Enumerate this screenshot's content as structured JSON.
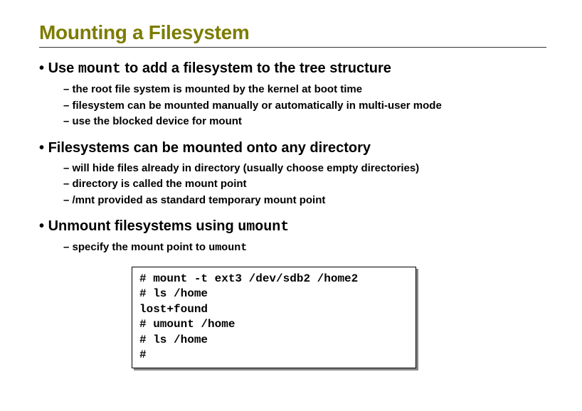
{
  "title": "Mounting a Filesystem",
  "bullets": [
    {
      "prefix": "Use ",
      "mono1": "mount",
      "after": " to add a filesystem to the tree structure",
      "subs": [
        "the root file system is mounted by the kernel at boot time",
        "filesystem can be mounted manually or automatically in multi-user mode",
        "use the blocked device for mount"
      ]
    },
    {
      "prefix": "Filesystems can be mounted onto any directory",
      "mono1": "",
      "after": "",
      "subs": [
        "will hide files already in directory (usually choose empty directories)",
        "directory is called the mount point",
        "/mnt provided as standard temporary mount point"
      ]
    },
    {
      "prefix": "Unmount filesystems using ",
      "mono1": "umount",
      "after": "",
      "subs_special": {
        "text_before": "specify the mount point to ",
        "mono": "umount"
      }
    }
  ],
  "code": "# mount -t ext3 /dev/sdb2 /home2\n# ls /home\nlost+found\n# umount /home\n# ls /home\n#"
}
